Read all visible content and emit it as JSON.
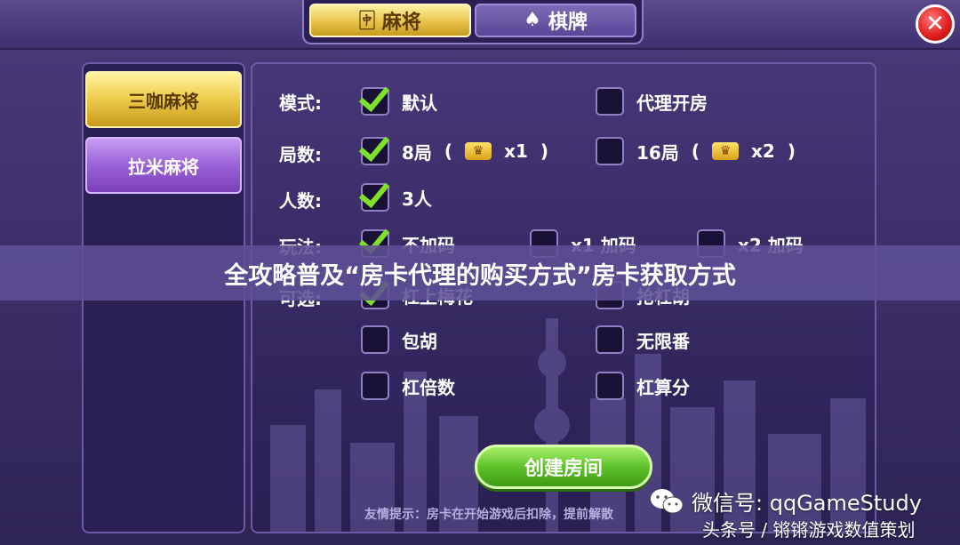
{
  "tabs": [
    {
      "label": "麻将",
      "icon": "mahjong-tile-icon",
      "active": true
    },
    {
      "label": "棋牌",
      "icon": "playing-cards-icon",
      "active": false
    }
  ],
  "close_icon": "close-icon",
  "sidebar": {
    "items": [
      {
        "label": "三咖麻将",
        "selected": true
      },
      {
        "label": "拉米麻将",
        "selected": false
      }
    ]
  },
  "form": {
    "mode": {
      "label": "模式:",
      "options": [
        {
          "label": "默认",
          "checked": true
        },
        {
          "label": "代理开房",
          "checked": false
        }
      ]
    },
    "rounds": {
      "label": "局数:",
      "options": [
        {
          "label": "8局",
          "cost": "x1",
          "checked": true
        },
        {
          "label": "16局",
          "cost": "x2",
          "checked": false
        }
      ]
    },
    "players": {
      "label": "人数:",
      "options": [
        {
          "label": "3人",
          "checked": true
        }
      ]
    },
    "play": {
      "label": "玩法:",
      "options": [
        {
          "label": "不加码",
          "checked": true
        },
        {
          "label": "x1 加码",
          "checked": false
        },
        {
          "label": "x2 加码",
          "checked": false
        }
      ]
    },
    "optional": {
      "label": "可选:",
      "options": [
        {
          "label": "杠上梅花",
          "checked": true
        },
        {
          "label": "抢杠胡",
          "checked": false
        },
        {
          "label": "包胡",
          "checked": false
        },
        {
          "label": "无限番",
          "checked": false
        },
        {
          "label": "杠倍数",
          "checked": false
        },
        {
          "label": "杠算分",
          "checked": false
        }
      ]
    }
  },
  "create_button": "创建房间",
  "tip": "友情提示：房卡在开始游戏后扣除，提前解散",
  "banner": "全攻略普及“房卡代理的购买方式”房卡获取方式",
  "watermark": {
    "line1": "微信号: qqGameStudy",
    "line2": "头条号 / 锵锵游戏数值策划"
  },
  "colors": {
    "gold": "#e8c24a",
    "purple": "#9a62d8",
    "green": "#5ec22a",
    "close_red": "#e02020"
  }
}
